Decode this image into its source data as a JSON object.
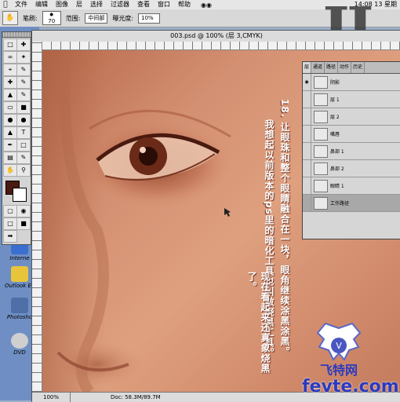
{
  "menubar": {
    "items": [
      "文件",
      "编辑",
      "图像",
      "层",
      "选择",
      "过滤器",
      "查看",
      "窗口",
      "帮助"
    ],
    "clock": "14:08 13 星期"
  },
  "options": {
    "brush_label": "笔刷:",
    "brush_size": "70",
    "range_label": "范围:",
    "range_value": "中间部",
    "exposure_label": "曝光度:",
    "exposure_value": "10%"
  },
  "document": {
    "title": "003.psd @ 100% (层 3,CMYK)",
    "zoom": "100%",
    "doc_size": "Doc: 58.3M/89.7M"
  },
  "caption": {
    "col1": "18. 让眼珠和整个眼睛融合在一块，眼角继续涂黑涂黑。",
    "col2": "我想起以前版本的ps里的暗化工具也叫做烧黑工具。",
    "col3": "现在看起来还真象烧黑了。"
  },
  "layers_palette": {
    "tabs": [
      "层",
      "通道",
      "路径",
      "动作",
      "历史"
    ],
    "layers": [
      {
        "name": "阴影"
      },
      {
        "name": "层 1"
      },
      {
        "name": "层 2"
      },
      {
        "name": "嘴唇"
      },
      {
        "name": "鼻部 1"
      },
      {
        "name": "鼻部 2"
      },
      {
        "name": "眼睛 1"
      },
      {
        "name": "工作路径"
      }
    ]
  },
  "desktop": {
    "icons": [
      {
        "label": "Interne"
      },
      {
        "label": "Outlook Ex"
      },
      {
        "label": "Photosho"
      },
      {
        "label": "DVD"
      }
    ]
  },
  "watermark": {
    "brand": "飞特网",
    "domain": "fevte.com"
  },
  "colors": {
    "foreground": "#4a1a12",
    "background": "#ffffff",
    "skin": "#d49072"
  }
}
